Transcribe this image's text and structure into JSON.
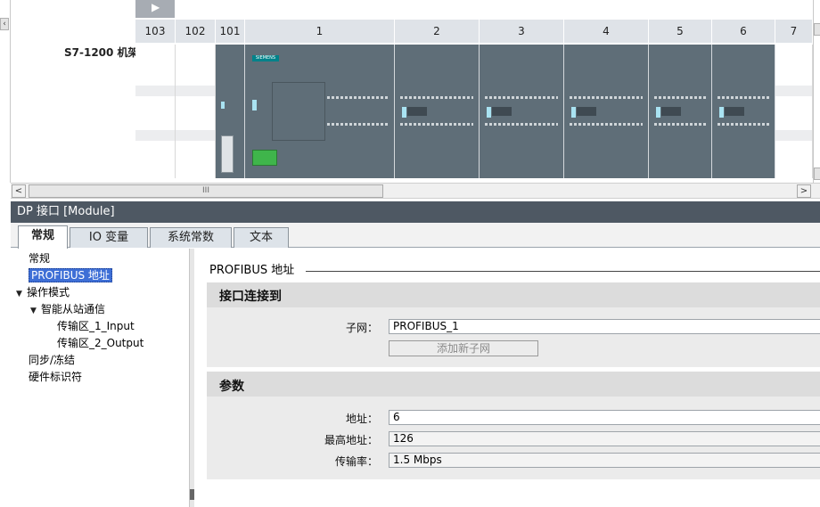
{
  "device_view": {
    "rack_name": "S7-1200 机架",
    "play_icon": "play-triangle-icon",
    "slot_numbers": [
      "103",
      "102",
      "101",
      "1",
      "2",
      "3",
      "4",
      "5",
      "6",
      "7"
    ],
    "cpu_brand": "SIEMENS"
  },
  "hscroll": {
    "left_arrow": "<",
    "right_arrow": ">",
    "thumb_grip": "III"
  },
  "inspector": {
    "title": "DP 接口 [Module]",
    "tabs": [
      "常规",
      "IO 变量",
      "系统常数",
      "文本"
    ],
    "active_tab": "常规",
    "tree": [
      {
        "label": "常规",
        "indent": 0,
        "caret": ""
      },
      {
        "label": "PROFIBUS 地址",
        "indent": 0,
        "caret": "",
        "selected": true
      },
      {
        "label": "操作模式",
        "indent": 0,
        "caret": "▼"
      },
      {
        "label": "智能从站通信",
        "indent": 1,
        "caret": "▼"
      },
      {
        "label": "传输区_1_Input",
        "indent": 2,
        "caret": ""
      },
      {
        "label": "传输区_2_Output",
        "indent": 2,
        "caret": ""
      },
      {
        "label": "同步/冻结",
        "indent": 0,
        "caret": ""
      },
      {
        "label": "硬件标识符",
        "indent": 0,
        "caret": ""
      }
    ],
    "content": {
      "section_title": "PROFIBUS 地址",
      "interface_group": {
        "title": "接口连接到",
        "subnet_label": "子网：",
        "subnet_value": "PROFIBUS_1",
        "add_subnet_label": "添加新子网"
      },
      "params_group": {
        "title": "参数",
        "address_label": "地址：",
        "address_value": "6",
        "max_address_label": "最高地址：",
        "max_address_value": "126",
        "baud_label": "传输率：",
        "baud_value": "1.5 Mbps"
      }
    }
  }
}
